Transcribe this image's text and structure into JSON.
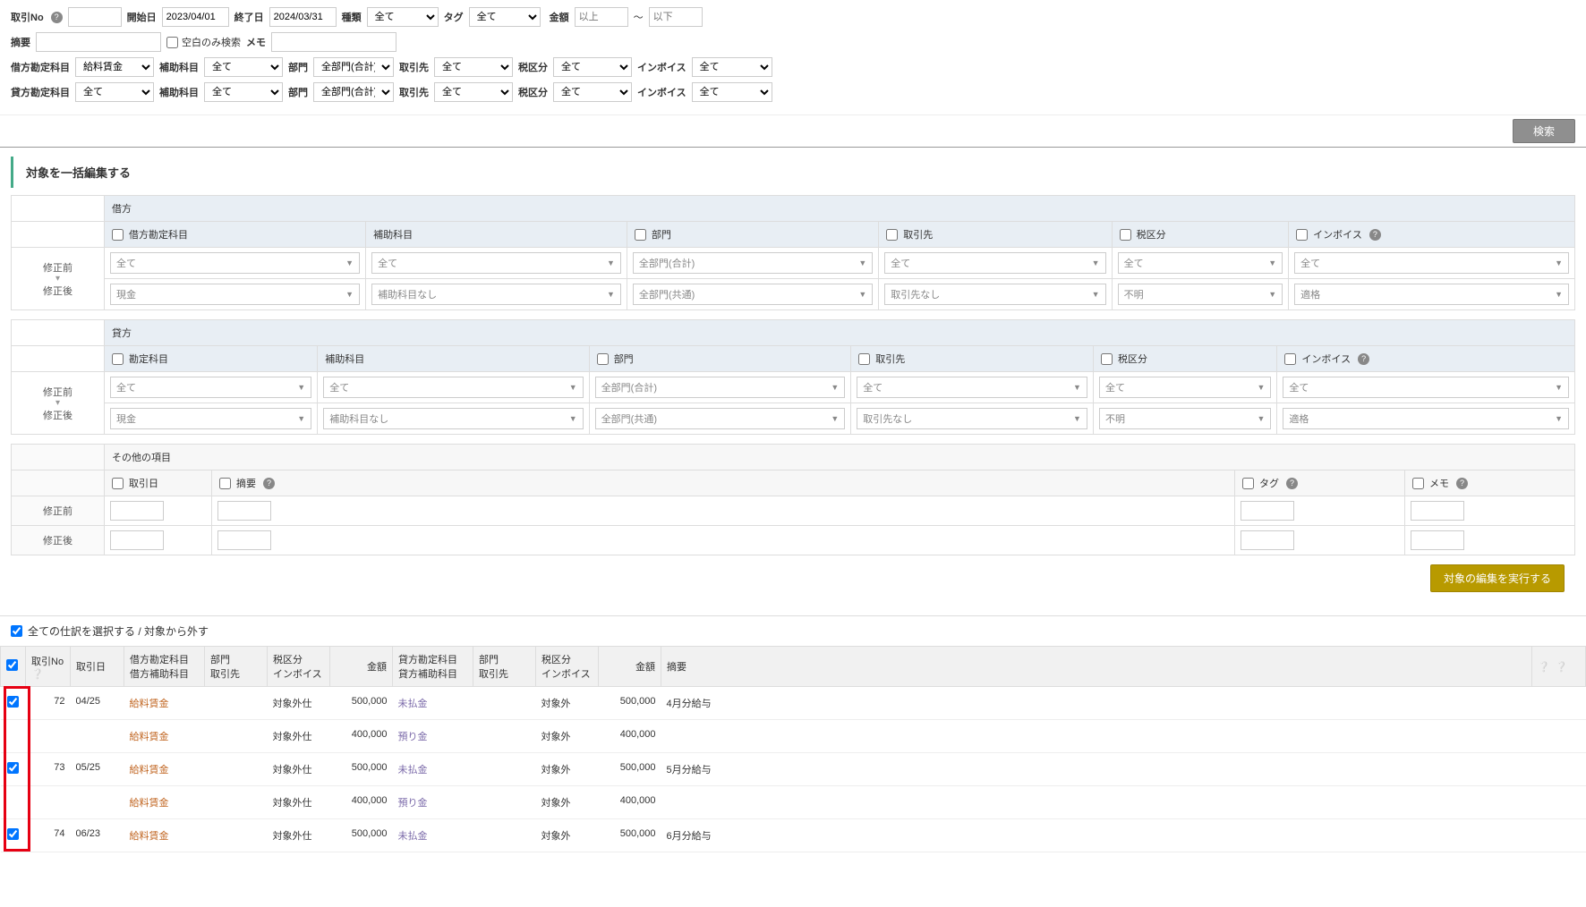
{
  "filters": {
    "txn_no_label": "取引No",
    "start_date_label": "開始日",
    "start_date": "2023/04/01",
    "end_date_label": "終了日",
    "end_date": "2024/03/31",
    "type_label": "種類",
    "type": "全て",
    "tag_label": "タグ",
    "tag": "全て",
    "amount_label": "金額",
    "amount_from_ph": "以上",
    "amount_to_ph": "以下",
    "tilde": "～",
    "summary_label": "摘要",
    "blank_only_label": "空白のみ検索",
    "memo_label": "メモ",
    "debit_account_label": "借方勘定科目",
    "debit_account": "給料賃金",
    "aux_account_label": "補助科目",
    "aux_account": "全て",
    "dept_label": "部門",
    "dept_all": "全部門(合計)",
    "partner_label": "取引先",
    "partner": "全て",
    "tax_label": "税区分",
    "tax": "全て",
    "invoice_label": "インボイス",
    "invoice": "全て",
    "credit_account_label": "貸方勘定科目",
    "credit_account": "全て",
    "search_btn": "検索"
  },
  "section_title": "対象を一括編集する",
  "edit": {
    "debit_header": "借方",
    "credit_header": "貸方",
    "col_debit_account": "借方勘定科目",
    "col_account": "勘定科目",
    "col_aux": "補助科目",
    "col_dept": "部門",
    "col_partner": "取引先",
    "col_tax": "税区分",
    "col_invoice": "インボイス",
    "before_label": "修正前",
    "after_label": "修正後",
    "before": {
      "account": "全て",
      "aux": "全て",
      "dept": "全部門(合計)",
      "partner": "全て",
      "tax": "全て",
      "invoice": "全て"
    },
    "after": {
      "account": "現金",
      "aux": "補助科目なし",
      "dept": "全部門(共通)",
      "partner": "取引先なし",
      "tax": "不明",
      "invoice": "適格"
    },
    "other_header": "その他の項目",
    "other_date": "取引日",
    "other_summary": "摘要",
    "other_tag": "タグ",
    "other_memo": "メモ"
  },
  "exec_btn": "対象の編集を実行する",
  "select_all_label": "全ての仕訳を選択する / 対象から外す",
  "list": {
    "headers": {
      "txn_no": "取引No",
      "txn_date": "取引日",
      "debit_account": "借方勘定科目",
      "debit_aux": "借方補助科目",
      "dept": "部門",
      "partner": "取引先",
      "tax": "税区分",
      "invoice": "インボイス",
      "amount": "金額",
      "credit_account": "貸方勘定科目",
      "credit_aux": "貸方補助科目",
      "summary": "摘要"
    },
    "rows": [
      {
        "no": "72",
        "date": "04/25",
        "debit": "給料賃金",
        "debit_tax": "対象外仕",
        "debit_amt": "500,000",
        "credit": "未払金",
        "credit_tax": "対象外",
        "credit_amt": "500,000",
        "summary": "4月分給与"
      },
      {
        "no": "",
        "date": "",
        "debit": "給料賃金",
        "debit_tax": "対象外仕",
        "debit_amt": "400,000",
        "credit": "預り金",
        "credit_tax": "対象外",
        "credit_amt": "400,000",
        "summary": ""
      },
      {
        "no": "73",
        "date": "05/25",
        "debit": "給料賃金",
        "debit_tax": "対象外仕",
        "debit_amt": "500,000",
        "credit": "未払金",
        "credit_tax": "対象外",
        "credit_amt": "500,000",
        "summary": "5月分給与"
      },
      {
        "no": "",
        "date": "",
        "debit": "給料賃金",
        "debit_tax": "対象外仕",
        "debit_amt": "400,000",
        "credit": "預り金",
        "credit_tax": "対象外",
        "credit_amt": "400,000",
        "summary": ""
      },
      {
        "no": "74",
        "date": "06/23",
        "debit": "給料賃金",
        "debit_tax": "対象外仕",
        "debit_amt": "500,000",
        "credit": "未払金",
        "credit_tax": "対象外",
        "credit_amt": "500,000",
        "summary": "6月分給与"
      }
    ]
  }
}
